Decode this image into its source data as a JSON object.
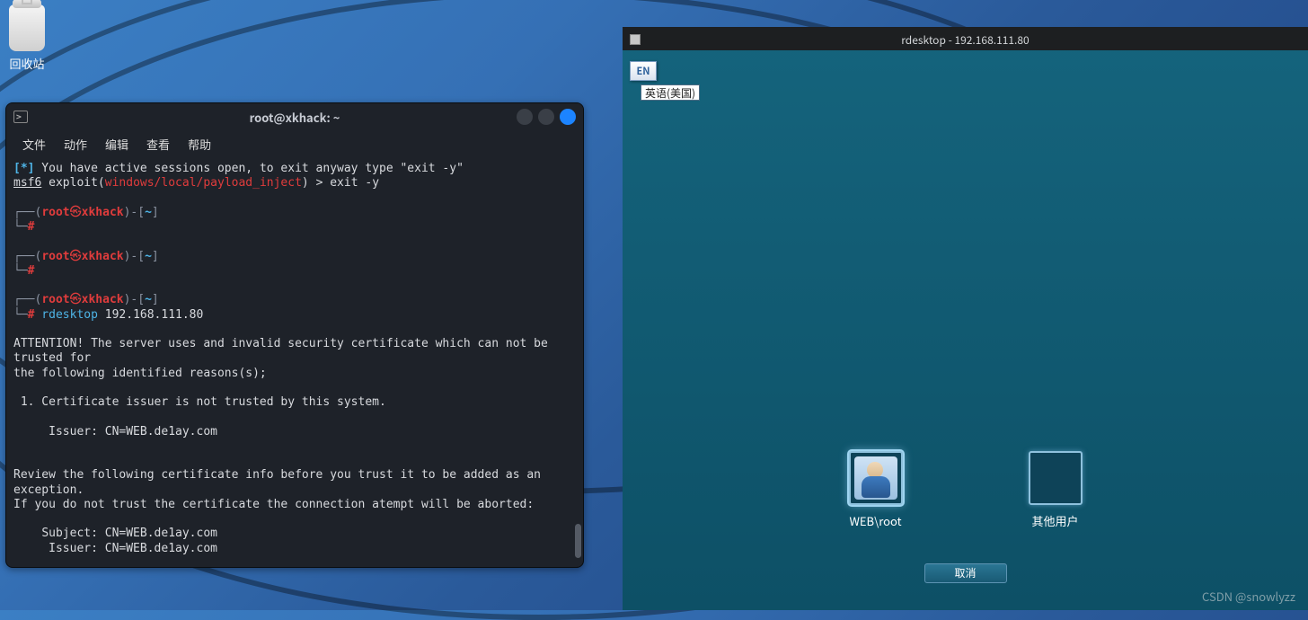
{
  "desktop": {
    "recycle_bin": "回收站"
  },
  "terminal": {
    "title": "root@xkhack: ~",
    "menu": {
      "file": "文件",
      "action": "动作",
      "edit": "编辑",
      "view": "查看",
      "help": "帮助"
    },
    "line_active_sessions_pre": "[*]",
    "line_active_sessions": " You have active sessions open, to exit anyway type \"exit -y\"",
    "msf_pre": "msf6",
    "msf_exploit_open": " exploit(",
    "msf_path": "windows/local/payload_inject",
    "msf_close": ") > exit -y",
    "prompt_open1": "┌──(",
    "prompt_user": "root",
    "prompt_sep": "㉿",
    "prompt_host": "xkhack",
    "prompt_close1": ")-[",
    "prompt_path": "~",
    "prompt_close2": "]",
    "prompt_line2_l": "└─",
    "prompt_line2_hash": "#",
    "cmd_rdesktop_cmd": " rdesktop",
    "cmd_rdesktop_arg": " 192.168.111.80",
    "attn_l1": "ATTENTION! The server uses and invalid security certificate which can not be trusted for",
    "attn_l2": "the following identified reasons(s);",
    "reason1": " 1. Certificate issuer is not trusted by this system.",
    "issuer1": "     Issuer: CN=WEB.de1ay.com",
    "review_l1": "Review the following certificate info before you trust it to be added as an exception.",
    "review_l2": "If you do not trust the certificate the connection atempt will be aborted:",
    "subject2": "    Subject: CN=WEB.de1ay.com",
    "issuer2": "     Issuer: CN=WEB.de1ay.com"
  },
  "rdp": {
    "title": "rdesktop - 192.168.111.80",
    "lang_badge": "EN",
    "lang_tip": "英语(美国)",
    "user1": "WEB\\root",
    "user2": "其他用户",
    "cancel": "取消"
  },
  "watermark": "CSDN @snowlyzz"
}
